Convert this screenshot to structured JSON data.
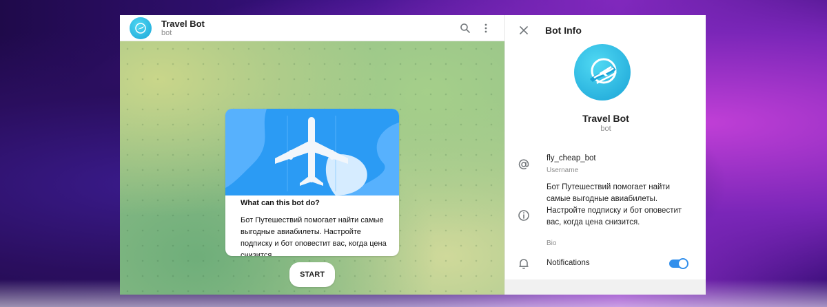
{
  "chat": {
    "title": "Travel Bot",
    "subtitle": "bot",
    "icons": [
      "search-icon",
      "more-vertical-icon"
    ]
  },
  "card": {
    "heading": "What can this bot do?",
    "description": "Бот Путешествий помогает найти самые выгодные авиабилеты. Настройте подписку и бот оповестит вас, когда цена снизится."
  },
  "start_label": "START",
  "info": {
    "header_title": "Bot Info",
    "name": "Travel Bot",
    "subtitle": "bot",
    "username": "fly_cheap_bot",
    "username_label": "Username",
    "bio": "Бот Путешествий помогает найти самые выгодные авиабилеты. Настройте подписку и бот оповестит вас, когда цена снизится.",
    "bio_label": "Bio",
    "notifications_label": "Notifications",
    "notifications_on": true
  },
  "colors": {
    "accent": "#3390ec",
    "avatar": "#1aa7d8",
    "card_image": "#2b9bf4"
  }
}
